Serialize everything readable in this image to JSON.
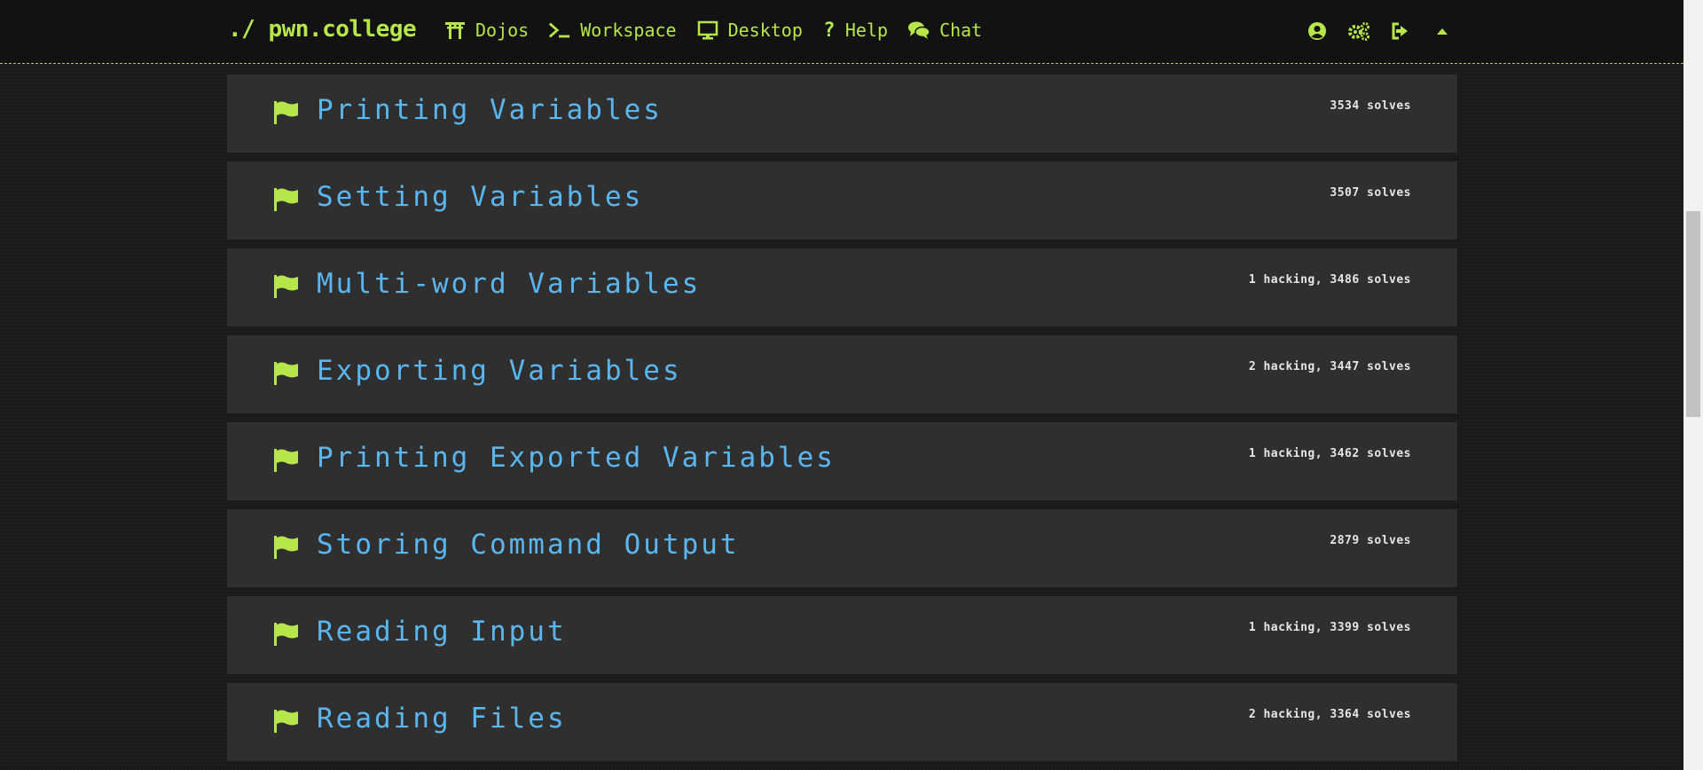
{
  "brand": "./ pwn.college",
  "nav": [
    {
      "label": "Dojos",
      "icon": "torii-gate-icon"
    },
    {
      "label": "Workspace",
      "icon": "terminal-icon"
    },
    {
      "label": "Desktop",
      "icon": "desktop-icon"
    },
    {
      "label": "Help",
      "icon": "question-icon"
    },
    {
      "label": "Chat",
      "icon": "chat-icon"
    }
  ],
  "header_icons": [
    "user-circle-icon",
    "settings-gears-icon",
    "logout-icon",
    "caret-up-icon"
  ],
  "colors": {
    "accent": "#b7e64a",
    "title": "#5bb6f0",
    "row_bg": "#2f2f2f",
    "page_bg": "#1a1a1a"
  },
  "challenges": [
    {
      "title": "Printing Variables",
      "stats": "3534 solves"
    },
    {
      "title": "Setting Variables",
      "stats": "3507 solves"
    },
    {
      "title": "Multi-word Variables",
      "stats": "1 hacking, 3486 solves"
    },
    {
      "title": "Exporting Variables",
      "stats": "2 hacking, 3447 solves"
    },
    {
      "title": "Printing Exported Variables",
      "stats": "1 hacking, 3462 solves"
    },
    {
      "title": "Storing Command Output",
      "stats": "2879 solves"
    },
    {
      "title": "Reading Input",
      "stats": "1 hacking, 3399 solves"
    },
    {
      "title": "Reading Files",
      "stats": "2 hacking, 3364 solves"
    }
  ]
}
